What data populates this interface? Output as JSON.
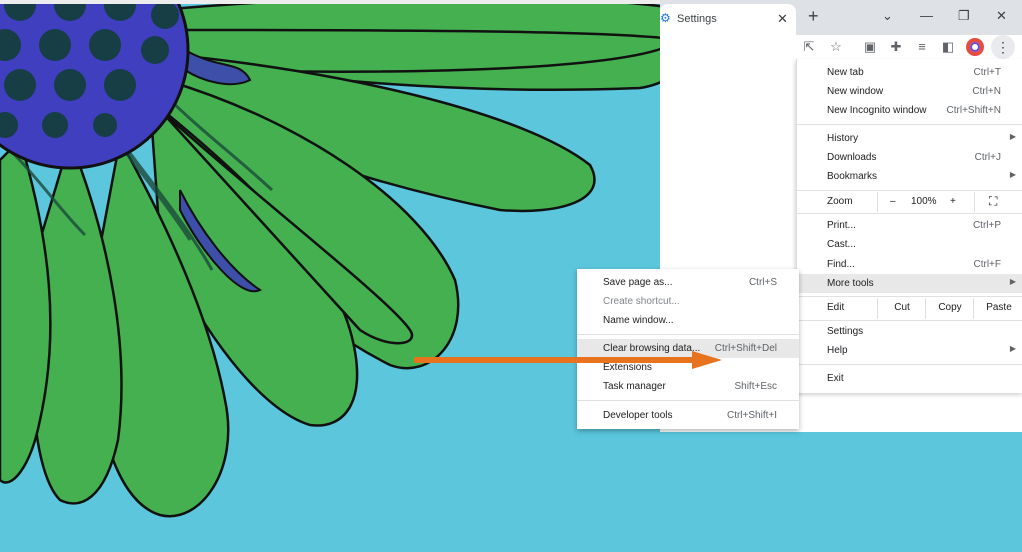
{
  "browser": {
    "tab_title": "Settings",
    "tab_icon": "gear-icon",
    "accent": "#1a73e8"
  },
  "menu": {
    "new_tab": {
      "label": "New tab",
      "shortcut": "Ctrl+T"
    },
    "new_window": {
      "label": "New window",
      "shortcut": "Ctrl+N"
    },
    "new_incognito": {
      "label": "New Incognito window",
      "shortcut": "Ctrl+Shift+N"
    },
    "history": {
      "label": "History"
    },
    "downloads": {
      "label": "Downloads",
      "shortcut": "Ctrl+J"
    },
    "bookmarks": {
      "label": "Bookmarks"
    },
    "zoom": {
      "label": "Zoom",
      "minus": "–",
      "value": "100%",
      "plus": "+"
    },
    "print": {
      "label": "Print...",
      "shortcut": "Ctrl+P"
    },
    "cast": {
      "label": "Cast..."
    },
    "find": {
      "label": "Find...",
      "shortcut": "Ctrl+F"
    },
    "more_tools": {
      "label": "More tools"
    },
    "edit": {
      "label": "Edit",
      "cut": "Cut",
      "copy": "Copy",
      "paste": "Paste"
    },
    "settings": {
      "label": "Settings"
    },
    "help": {
      "label": "Help"
    },
    "exit": {
      "label": "Exit"
    }
  },
  "submenu": {
    "save_page": {
      "label": "Save page as...",
      "shortcut": "Ctrl+S"
    },
    "create_shortcut": {
      "label": "Create shortcut..."
    },
    "name_window": {
      "label": "Name window..."
    },
    "clear_browsing": {
      "label": "Clear browsing data...",
      "shortcut": "Ctrl+Shift+Del"
    },
    "extensions": {
      "label": "Extensions"
    },
    "task_manager": {
      "label": "Task manager",
      "shortcut": "Shift+Esc"
    },
    "developer_tools": {
      "label": "Developer tools",
      "shortcut": "Ctrl+Shift+I"
    }
  },
  "colors": {
    "background": "#5bc6dc",
    "petal": "#44b050",
    "flower_center": "#3f3fc0",
    "arrow": "#e8731f"
  }
}
